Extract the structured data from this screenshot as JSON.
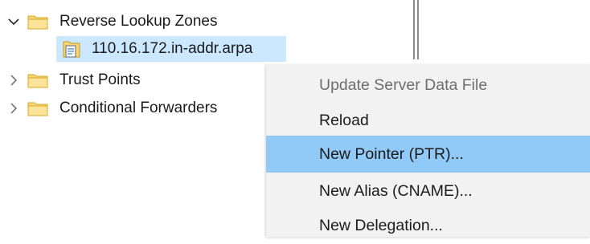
{
  "tree": {
    "items": [
      {
        "label": "Reverse Lookup Zones",
        "expanded": true,
        "chevron": "chevron-down-icon",
        "icon": "folder-icon"
      },
      {
        "label": "110.16.172.in-addr.arpa",
        "selected": true,
        "icon": "zone-file-icon"
      },
      {
        "label": "Trust Points",
        "expanded": false,
        "chevron": "chevron-right-icon",
        "icon": "folder-icon"
      },
      {
        "label": "Conditional Forwarders",
        "expanded": false,
        "chevron": "chevron-right-icon",
        "icon": "folder-icon"
      }
    ]
  },
  "context_menu": {
    "items": [
      {
        "label": "Update Server Data File",
        "enabled": false
      },
      {
        "label": "Reload",
        "enabled": true
      },
      {
        "label": "New Pointer (PTR)...",
        "enabled": true,
        "highlighted": true
      },
      {
        "label": "New Alias (CNAME)...",
        "enabled": true
      },
      {
        "label": "New Delegation...",
        "enabled": true
      }
    ]
  },
  "colors": {
    "selection": "#cce8ff",
    "menu_highlight": "#91c9f7",
    "menu_background": "#f2f2f2",
    "folder": "#f8d775"
  }
}
